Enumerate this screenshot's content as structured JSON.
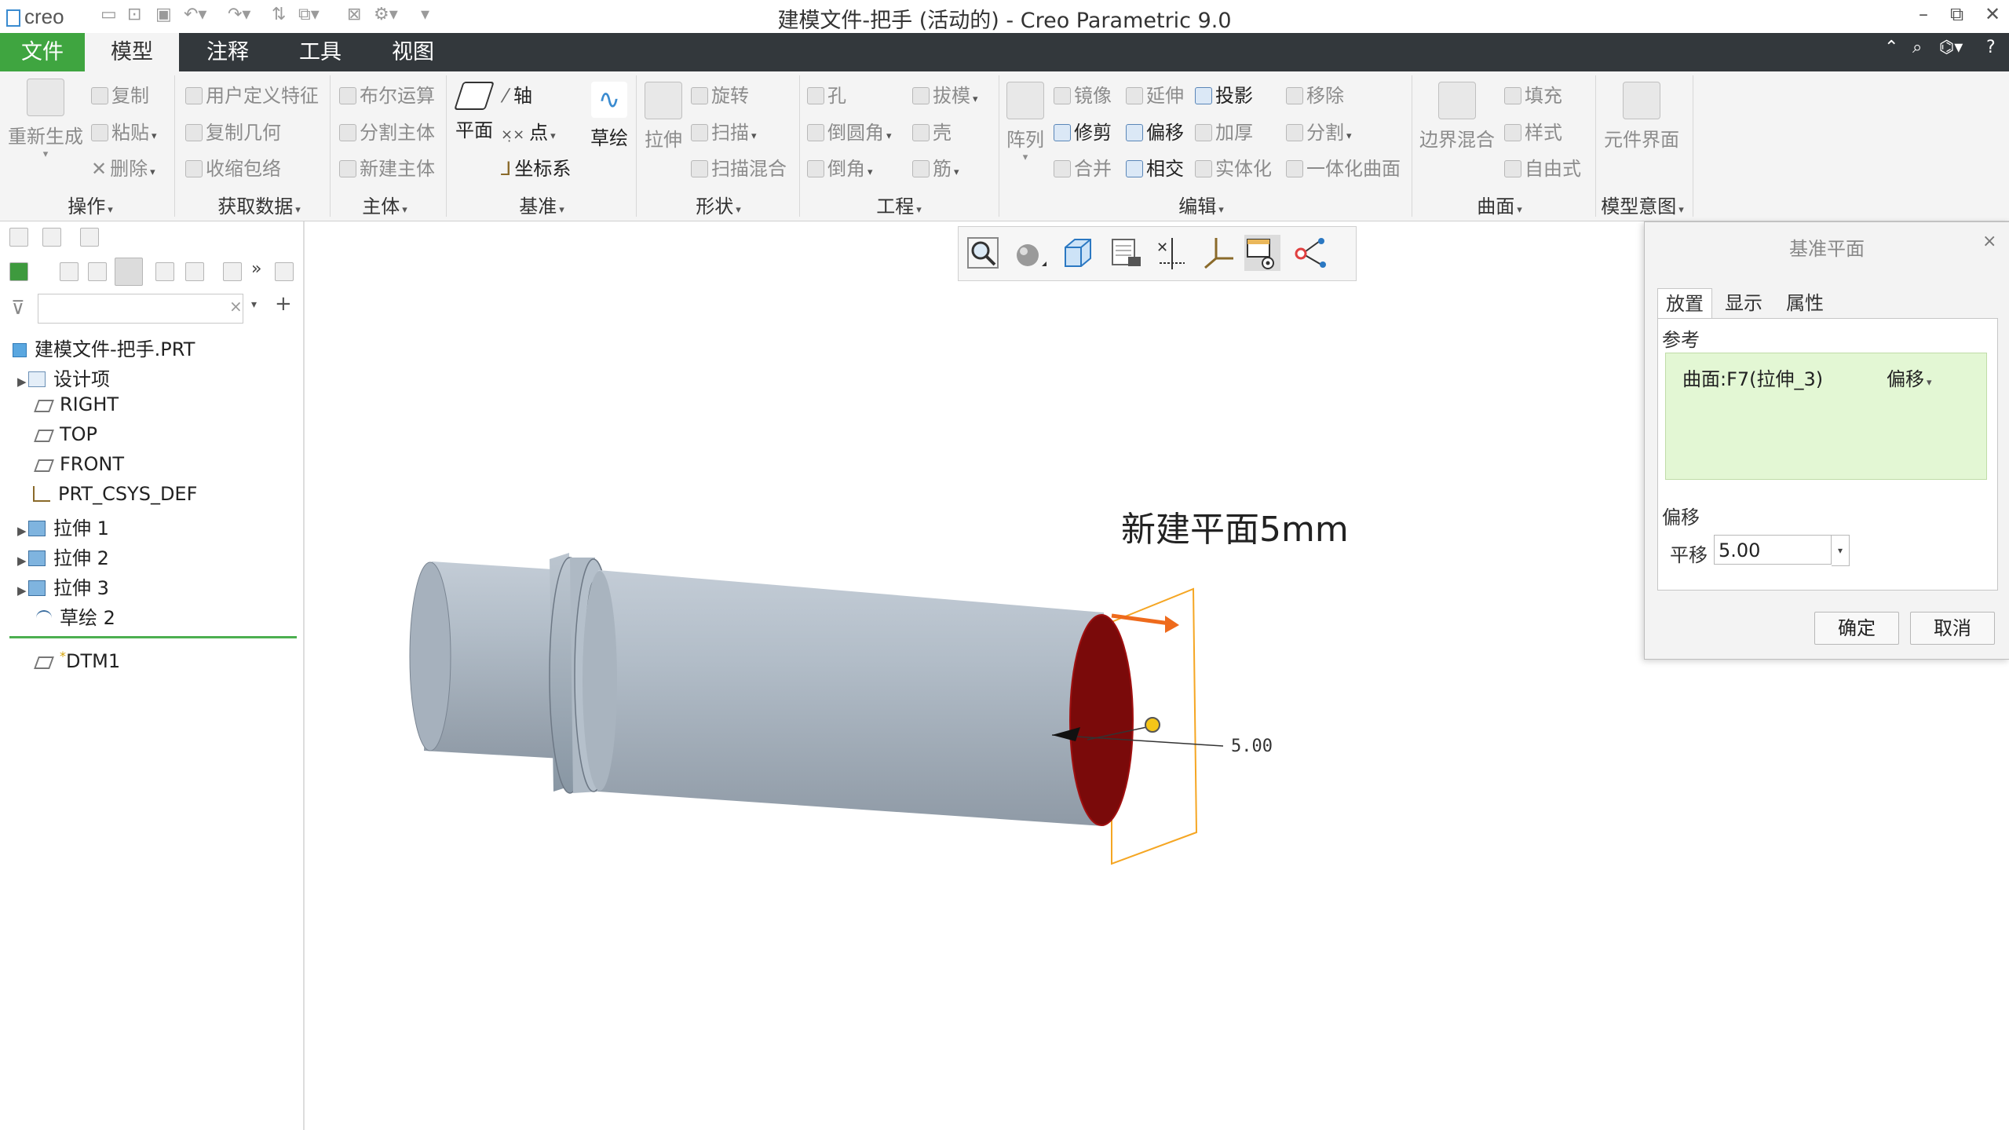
{
  "title_bar": {
    "logo": "creo",
    "window_title": "建模文件-把手 (活动的) - Creo Parametric 9.0",
    "quick_access_icons": [
      "new-icon",
      "open-icon",
      "save-icon",
      "undo-icon",
      "redo-icon",
      "regenerate-icon",
      "switch-window-icon",
      "close-window-icon",
      "settings-icon",
      "customize-icon"
    ],
    "window_controls": [
      "minimize",
      "restore",
      "close"
    ]
  },
  "menu": {
    "tabs": [
      "文件",
      "模型",
      "注释",
      "工具",
      "视图"
    ],
    "active_tab": "模型"
  },
  "ribbon": {
    "groups": {
      "operations": {
        "label": "操作",
        "regenerate": "重新生成",
        "copy": "复制",
        "paste": "粘贴",
        "delete": "删除"
      },
      "get_data": {
        "label": "获取数据",
        "udf": "用户定义特征",
        "copy_geom": "复制几何",
        "shrinkwrap": "收缩包络"
      },
      "body": {
        "label": "主体",
        "boolean": "布尔运算",
        "split_body": "分割主体",
        "new_body": "新建主体"
      },
      "datum": {
        "label": "基准",
        "plane": "平面",
        "axis": "轴",
        "point": "点",
        "csys": "坐标系",
        "sketch": "草绘"
      },
      "shapes": {
        "label": "形状",
        "extrude": "拉伸",
        "revolve": "旋转",
        "sweep": "扫描",
        "swept_blend": "扫描混合"
      },
      "engineering": {
        "label": "工程",
        "hole": "孔",
        "round": "倒圆角",
        "chamfer": "倒角",
        "draft": "拔模",
        "shell": "壳",
        "rib": "筋"
      },
      "editing": {
        "label": "编辑",
        "pattern": "阵列",
        "mirror": "镜像",
        "trim": "修剪",
        "merge": "合并",
        "extend": "延伸",
        "offset": "偏移",
        "intersect": "相交",
        "project": "投影",
        "thicken": "加厚",
        "solidify": "实体化",
        "remove": "移除",
        "split": "分割",
        "unify_surface": "一体化曲面"
      },
      "surfaces": {
        "label": "曲面",
        "boundary_blend": "边界混合",
        "fill": "填充",
        "style": "样式",
        "freestyle": "自由式"
      },
      "model_intent": {
        "label": "模型意图",
        "component_interface": "元件界面"
      }
    }
  },
  "model_tree": {
    "filter_placeholder": "",
    "root": "建模文件-把手.PRT",
    "items": [
      {
        "label": "设计项",
        "icon": "design-items-icon",
        "expandable": true
      },
      {
        "label": "RIGHT",
        "icon": "datum-plane-icon",
        "expandable": false
      },
      {
        "label": "TOP",
        "icon": "datum-plane-icon",
        "expandable": false
      },
      {
        "label": "FRONT",
        "icon": "datum-plane-icon",
        "expandable": false
      },
      {
        "label": "PRT_CSYS_DEF",
        "icon": "csys-icon",
        "expandable": false
      },
      {
        "label": "拉伸 1",
        "icon": "extrude-icon",
        "expandable": true
      },
      {
        "label": "拉伸 2",
        "icon": "extrude-icon",
        "expandable": true
      },
      {
        "label": "拉伸 3",
        "icon": "extrude-icon",
        "expandable": true
      },
      {
        "label": "草绘 2",
        "icon": "sketch-icon",
        "expandable": false
      }
    ],
    "new_item": {
      "label": "DTM1",
      "marker": "*"
    }
  },
  "viewport": {
    "annotation": "新建平面5mm",
    "dimension_label": "5.00",
    "toolbar_icons": [
      "refit-icon",
      "display-style-icon",
      "saved-views-icon",
      "view-manager-icon",
      "datum-display-icon",
      "csys-display-icon",
      "annotation-display-icon",
      "spin-center-icon"
    ],
    "colors": {
      "cylinder": "#b1bdc9",
      "selected_surface": "#7a0a0a",
      "datum_plane": "#f5a623",
      "drag_arrow": "#ee6a1c"
    }
  },
  "dialog": {
    "title": "基准平面",
    "tabs": [
      "放置",
      "显示",
      "属性"
    ],
    "active_tab": "放置",
    "references_label": "参考",
    "reference": "曲面:F7(拉伸_3)",
    "constraint": "偏移",
    "offset_label": "偏移",
    "translation_label": "平移",
    "translation_value": "5.00",
    "ok": "确定",
    "cancel": "取消"
  }
}
